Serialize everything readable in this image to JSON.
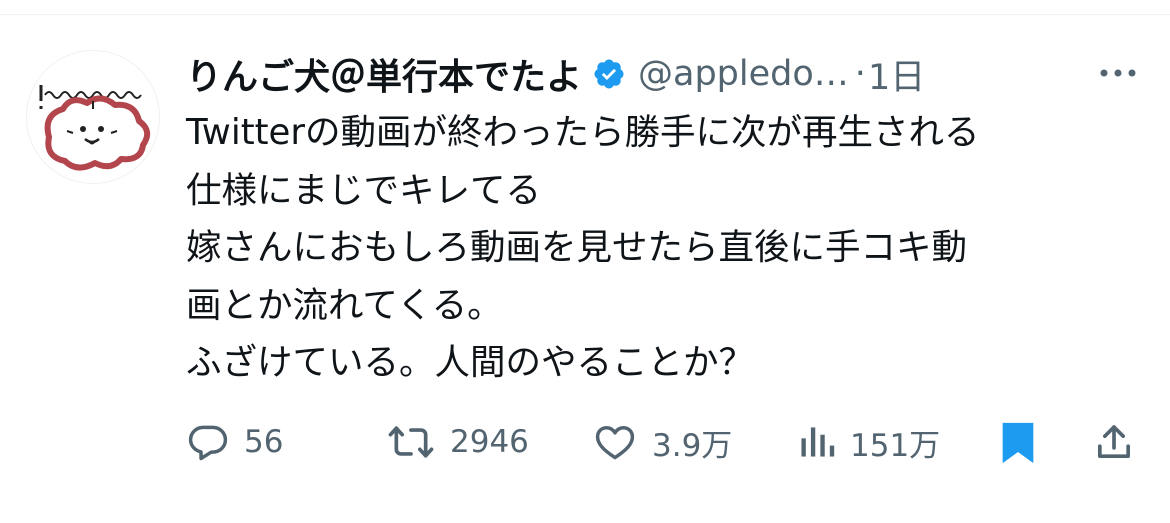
{
  "tweet": {
    "author": {
      "display_name": "りんご犬＠単行本でたよ",
      "handle": "@appledo…",
      "verified": true,
      "avatar_icon": "cartoon-dog-avatar"
    },
    "separator": "·",
    "time": "1日",
    "text_lines": [
      "Twitterの動画が終わったら勝手に次が再生される",
      "仕様にまじでキレてる",
      "嫁さんにおもしろ動画を見せたら直後に手コキ動",
      "画とか流れてくる。",
      "ふざけている。人間のやることか？"
    ],
    "actions": {
      "reply": "56",
      "retweet": "2946",
      "like": "3.9万",
      "views": "151万"
    },
    "colors": {
      "accent": "#1d9bf0",
      "text": "#0f1419",
      "secondary": "#536471"
    }
  }
}
